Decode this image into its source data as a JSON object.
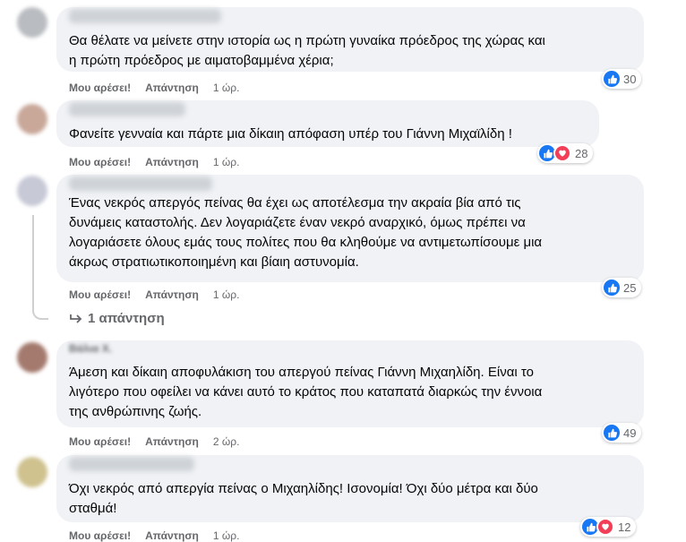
{
  "colors": {
    "accent": "#1877f2",
    "love": "#f33e58",
    "bubble": "#f0f2f5",
    "meta": "#65676b"
  },
  "labels": {
    "like": "Μου αρέσει!",
    "reply": "Απάντηση"
  },
  "comments": [
    {
      "author": "",
      "text": "Θα θέλατε να μείνετε στην ιστορία ως η πρώτη γυναίκα πρόεδρος της χώρας και\nη πρώτη πρόεδρος με αιματοβαμμένα χέρια;",
      "time": "1 ώρ.",
      "reaction_icons": [
        "like-icon"
      ],
      "reaction_count": "30"
    },
    {
      "author": "",
      "text": "Φανείτε γενναία και πάρτε μια δίκαιη απόφαση υπέρ του Γιάννη Μιχαϊλίδη !",
      "time": "1 ώρ.",
      "reaction_icons": [
        "like-icon",
        "love-icon"
      ],
      "reaction_count": "28"
    },
    {
      "author": "",
      "text": "Ένας νεκρός απεργός πείνας θα έχει ως αποτέλεσμα την ακραία βία από τις\nδυνάμεις καταστολής. Δεν λογαριάζετε έναν νεκρό αναρχικό, όμως πρέπει να\nλογαριάσετε όλους εμάς τους πολίτες που θα κληθούμε να αντιμετωπίσουμε μια\nάκρως στρατιωτικοποιημένη και βίαιη αστυνομία.",
      "time": "1 ώρ.",
      "reaction_icons": [
        "like-icon"
      ],
      "reaction_count": "25",
      "replies_label": "1 απάντηση"
    },
    {
      "author": "Βάλια Χ.",
      "text": "Άμεση και δίκαιη αποφυλάκιση του απεργού πείνας Γιάννη Μιχαηλίδη. Είναι το\nλιγότερο που οφείλει να κάνει αυτό το κράτος που καταπατά διαρκώς την έννοια\nτης ανθρώπινης ζωής.",
      "time": "2 ώρ.",
      "reaction_icons": [
        "like-icon"
      ],
      "reaction_count": "49"
    },
    {
      "author": "",
      "text": "Όχι νεκρός από απεργία πείνας ο Μιχαηλίδης! Ισονομία! Όχι δύο μέτρα και δύο\nσταθμά!",
      "time": "1 ώρ.",
      "reaction_icons": [
        "like-icon",
        "love-icon"
      ],
      "reaction_count": "12"
    }
  ]
}
